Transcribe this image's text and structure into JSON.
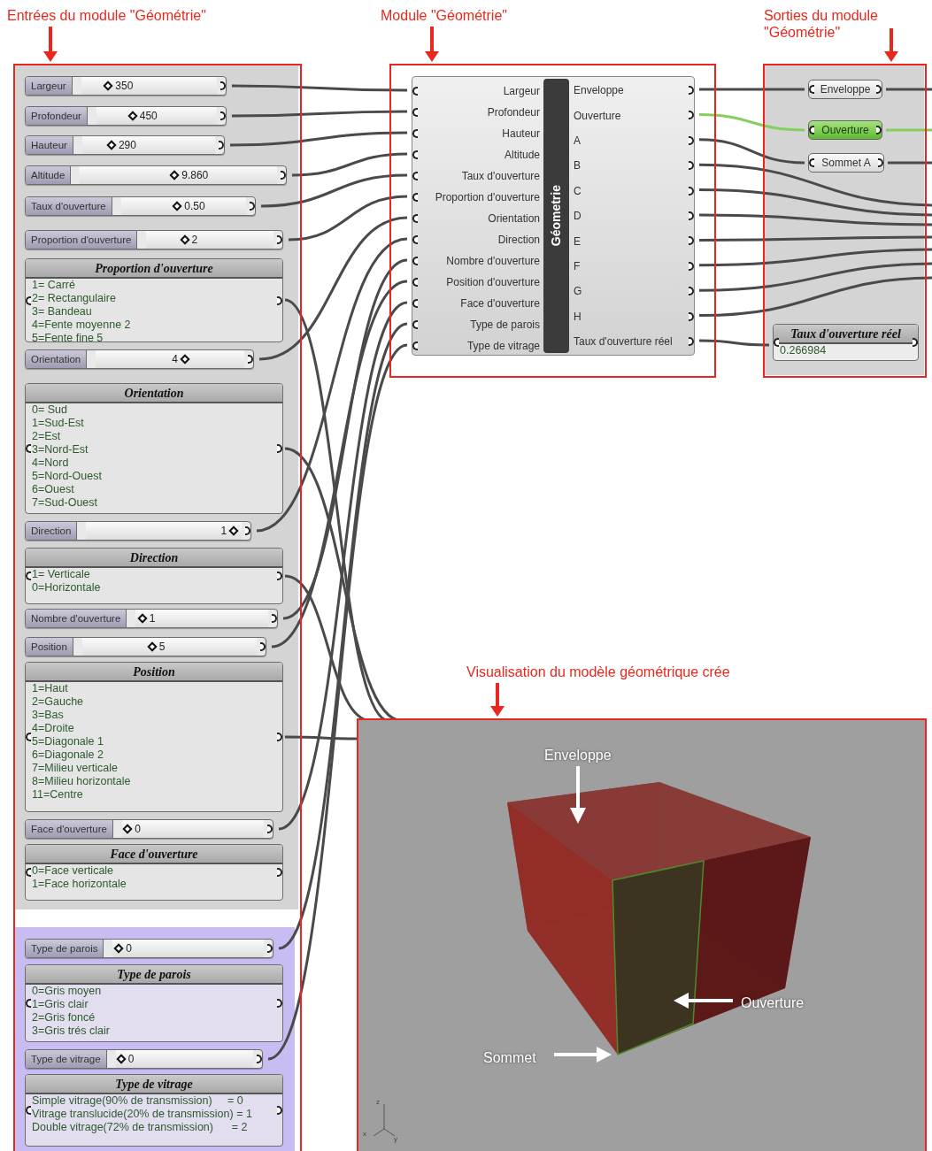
{
  "annotations": [
    {
      "text": "Entrées du module \"Géométrie\""
    },
    {
      "text": "Module \"Géométrie\""
    },
    {
      "text": "Sorties du module \"Géométrie\""
    },
    {
      "text": "Visualisation du modèle géométrique crée"
    }
  ],
  "inputs": {
    "groups": [
      {
        "color": "#d4d4d4",
        "items": [
          {
            "kind": "slider",
            "label": "Largeur",
            "value": "350",
            "level": 0.2
          },
          {
            "kind": "slider",
            "label": "Profondeur",
            "value": "450",
            "level": 0.3
          },
          {
            "kind": "slider",
            "label": "Hauteur",
            "value": "290",
            "level": 0.22
          },
          {
            "kind": "slider",
            "label": "Altitude",
            "value": "9.860",
            "level": 0.48
          },
          {
            "kind": "slider",
            "label": "Taux d'ouverture",
            "value": "0.50",
            "level": 0.45
          },
          {
            "kind": "slider",
            "label": "Proportion d'ouverture",
            "value": "2",
            "level": 0.3
          },
          {
            "kind": "panel",
            "title": "Proportion d'ouverture",
            "lines": [
              "1= Carré",
              "2= Rectangulaire",
              "3= Bandeau",
              "4=Fente moyenne 2",
              "5=Fente fine 5"
            ]
          },
          {
            "kind": "slider",
            "label": "Orientation",
            "value": "4",
            "level": 0.6
          },
          {
            "kind": "panel",
            "title": "Orientation",
            "lines": [
              "0= Sud",
              "1=Sud-Est",
              "2=Est",
              "3=Nord-Est",
              "4=Nord",
              "5=Nord-Ouest",
              "6=Ouest",
              "7=Sud-Ouest"
            ]
          },
          {
            "kind": "slider",
            "label": "Direction",
            "value": "1",
            "level": 0.95
          },
          {
            "kind": "panel",
            "title": "Direction",
            "lines": [
              "1= Verticale",
              "0=Horizontale"
            ]
          },
          {
            "kind": "slider",
            "label": "Nombre d'ouverture",
            "value": "1",
            "level": 0.05
          },
          {
            "kind": "slider",
            "label": "Position",
            "value": "5",
            "level": 0.4
          },
          {
            "kind": "panel",
            "title": "Position",
            "lines": [
              "1=Haut",
              "2=Gauche",
              "3=Bas",
              "4=Droite",
              "5=Diagonale 1",
              "6=Diagonale 2",
              "7=Milieu verticale",
              "8=Milieu horizontale",
              "11=Centre"
            ]
          },
          {
            "kind": "slider",
            "label": "Face d'ouverture",
            "value": "0",
            "level": 0.04
          },
          {
            "kind": "panel",
            "title": "Face d'ouverture",
            "lines": [
              "0=Face verticale",
              "1=Face horizontale"
            ]
          }
        ]
      },
      {
        "color": "#c9bcf3",
        "items": [
          {
            "kind": "slider",
            "label": "Type de parois",
            "value": "0",
            "level": 0.04
          },
          {
            "kind": "panel",
            "title": "Type de parois",
            "lines": [
              "0=Gris moyen",
              "1=Gris clair",
              "2=Gris foncé",
              "3=Gris trés clair"
            ]
          },
          {
            "kind": "slider",
            "label": "Type de vitrage",
            "value": "0",
            "level": 0.04
          },
          {
            "kind": "panel",
            "title": "Type de vitrage",
            "lines": [
              "Simple vitrage(90% de transmission)     = 0",
              "Vitrage translucide(20% de transmission) = 1",
              "Double vitrage(72% de transmission)      = 2"
            ]
          }
        ]
      }
    ]
  },
  "module": {
    "name": "Géometrie",
    "inputs": [
      "Largeur",
      "Profondeur",
      "Hauteur",
      "Altitude",
      "Taux d'ouverture",
      "Proportion d'ouverture",
      "Orientation",
      "Direction",
      "Nombre d'ouverture",
      "Position d'ouverture",
      "Face d'ouverture",
      "Type de parois",
      "Type de vitrage"
    ],
    "outputs": [
      "Enveloppe",
      "Ouverture",
      "A",
      "B",
      "C",
      "D",
      "E",
      "F",
      "G",
      "H",
      "Taux d'ouverture réel"
    ]
  },
  "outputs": {
    "items": [
      {
        "kind": "param",
        "label": "Enveloppe",
        "selected": false
      },
      {
        "kind": "param",
        "label": "Ouverture",
        "selected": true
      },
      {
        "kind": "param",
        "label": "Sommet A",
        "selected": false
      },
      {
        "kind": "panel",
        "title": "Taux d'ouverture réel",
        "value": "0.266984"
      }
    ]
  },
  "viewport": {
    "labels": [
      {
        "text": "Enveloppe"
      },
      {
        "text": "Ouverture"
      },
      {
        "text": "Sommet"
      }
    ],
    "axes": [
      "z",
      "x",
      "y"
    ]
  }
}
